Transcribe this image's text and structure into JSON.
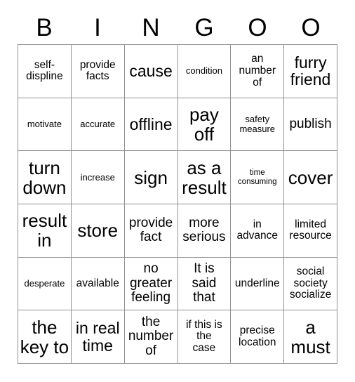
{
  "card": {
    "header": {
      "letters": [
        "B",
        "I",
        "N",
        "G",
        "O",
        "O"
      ]
    },
    "colors": {
      "border": "#909090",
      "text": "#000000",
      "background": "#ffffff"
    },
    "rows": [
      [
        {
          "text": "self-\ndispline",
          "size": "sm"
        },
        {
          "text": "provide\nfacts",
          "size": "sm"
        },
        {
          "text": "cause",
          "size": "lg"
        },
        {
          "text": "condition",
          "size": "xs"
        },
        {
          "text": "an\nnumber\nof",
          "size": "sm"
        },
        {
          "text": "furry\nfriend",
          "size": "lg"
        }
      ],
      [
        {
          "text": "motivate",
          "size": "xs"
        },
        {
          "text": "accurate",
          "size": "xs"
        },
        {
          "text": "offline",
          "size": "lg"
        },
        {
          "text": "pay\noff",
          "size": "xl"
        },
        {
          "text": "safety\nmeasure",
          "size": "xs"
        },
        {
          "text": "publish",
          "size": "md"
        }
      ],
      [
        {
          "text": "turn\ndown",
          "size": "xl"
        },
        {
          "text": "increase",
          "size": "xs"
        },
        {
          "text": "sign",
          "size": "xl"
        },
        {
          "text": "as a\nresult",
          "size": "xl"
        },
        {
          "text": "time\nconsuming",
          "size": "xxs"
        },
        {
          "text": "cover",
          "size": "xl"
        }
      ],
      [
        {
          "text": "result\nin",
          "size": "xl"
        },
        {
          "text": "store",
          "size": "xl"
        },
        {
          "text": "provide\nfact",
          "size": "md"
        },
        {
          "text": "more\nserious",
          "size": "md"
        },
        {
          "text": "in\nadvance",
          "size": "sm"
        },
        {
          "text": "limited\nresource",
          "size": "sm"
        }
      ],
      [
        {
          "text": "desperate",
          "size": "xs"
        },
        {
          "text": "available",
          "size": "sm"
        },
        {
          "text": "no\ngreater\nfeeling",
          "size": "md"
        },
        {
          "text": "It is\nsaid\nthat",
          "size": "md"
        },
        {
          "text": "underline",
          "size": "sm"
        },
        {
          "text": "social\nsociety\nsocialize",
          "size": "sm"
        }
      ],
      [
        {
          "text": "the\nkey to",
          "size": "xl"
        },
        {
          "text": "in real\ntime",
          "size": "lg"
        },
        {
          "text": "the\nnumber\nof",
          "size": "md"
        },
        {
          "text": "if this is\nthe\ncase",
          "size": "sm"
        },
        {
          "text": "precise\nlocation",
          "size": "sm"
        },
        {
          "text": "a\nmust",
          "size": "xl"
        }
      ]
    ]
  }
}
